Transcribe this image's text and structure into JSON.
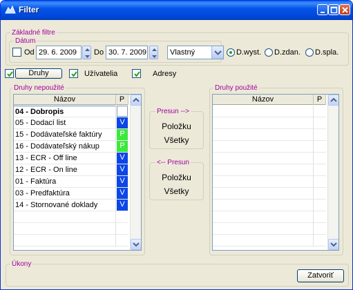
{
  "window": {
    "title": "Filter"
  },
  "basic_filters": {
    "legend": "Základné filtre",
    "date": {
      "legend": "Dátum",
      "from_label": "Od",
      "from_value": "29. 6. 2009",
      "to_label": "Do",
      "to_value": "30. 7. 2009",
      "period_value": "Vlastný"
    },
    "radios": [
      {
        "label": "D.wyst.",
        "selected": true
      },
      {
        "label": "D.zdan.",
        "selected": false
      },
      {
        "label": "D.spla.",
        "selected": false
      }
    ]
  },
  "toggles": {
    "druhy_label": "Druhy",
    "uzivatelia_label": "Užívatelia",
    "adresy_label": "Adresy"
  },
  "unused": {
    "legend": "Druhy nepoužité",
    "col_name": "Názov",
    "col_p": "P",
    "rows": [
      {
        "name": "04 - Dobropis",
        "p": ""
      },
      {
        "name": "05 - Dodací list",
        "p": "V"
      },
      {
        "name": "15 - Dodávateľské faktúry",
        "p": "P"
      },
      {
        "name": "16 - Dodávateľský nákup",
        "p": "P"
      },
      {
        "name": "13 - ECR - Off line",
        "p": "V"
      },
      {
        "name": "12 - ECR - On line",
        "p": "V"
      },
      {
        "name": "01 - Faktúra",
        "p": "V"
      },
      {
        "name": "03 - Predfaktúra",
        "p": "V"
      },
      {
        "name": "14 - Stornované doklady",
        "p": "V"
      }
    ]
  },
  "move_right": {
    "legend": "Presun -->",
    "item_label": "Položku",
    "all_label": "Všetky"
  },
  "move_left": {
    "legend": "<-- Presun",
    "item_label": "Položku",
    "all_label": "Všetky"
  },
  "used": {
    "legend": "Druhy použité",
    "col_name": "Názov",
    "col_p": "P"
  },
  "actions": {
    "legend": "Úkony",
    "close_label": "Zatvoriť"
  },
  "colors": {
    "title_bar": "#0054e3",
    "legend": "#a000a0",
    "p_v": "#0c46e8",
    "p_p": "#3de83d"
  }
}
